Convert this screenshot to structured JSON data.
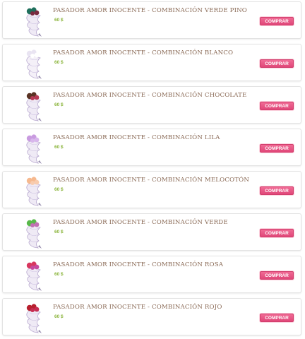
{
  "products": [
    {
      "title": "PASADOR AMOR INOCENTE - COMBINACIÓN VERDE PINO",
      "price": "60 $",
      "button": "COMPRAR",
      "colors": [
        "#1f6f5c",
        "#7a2b40",
        "#efeaf5"
      ]
    },
    {
      "title": "PASADOR AMOR INOCENTE - COMBINACIÓN BLANCO",
      "price": "60 $",
      "button": "COMPRAR",
      "colors": [
        "#e9e4f2",
        "#ffffff",
        "#f4f0f8"
      ]
    },
    {
      "title": "PASADOR AMOR INOCENTE - COMBINACIÓN CHOCOLATE",
      "price": "60 $",
      "button": "COMPRAR",
      "colors": [
        "#5a3324",
        "#b73a55",
        "#efeaf5"
      ]
    },
    {
      "title": "PASADOR AMOR INOCENTE - COMBINACIÓN LILA",
      "price": "60 $",
      "button": "COMPRAR",
      "colors": [
        "#c99be0",
        "#d8b6ec",
        "#efeaf5"
      ]
    },
    {
      "title": "PASADOR AMOR INOCENTE - COMBINACIÓN MELOCOTÓN",
      "price": "60 $",
      "button": "COMPRAR",
      "colors": [
        "#f6b98f",
        "#f9ccae",
        "#efeaf5"
      ]
    },
    {
      "title": "PASADOR AMOR INOCENTE - COMBINACIÓN VERDE",
      "price": "60 $",
      "button": "COMPRAR",
      "colors": [
        "#58b84a",
        "#c26fb4",
        "#efeaf5"
      ]
    },
    {
      "title": "PASADOR AMOR INOCENTE - COMBINACIÓN ROSA",
      "price": "60 $",
      "button": "COMPRAR",
      "colors": [
        "#d8375f",
        "#c64a9e",
        "#efeaf5"
      ]
    },
    {
      "title": "PASADOR AMOR INOCENTE - COMBINACIÓN ROJO",
      "price": "60 $",
      "button": "COMPRAR",
      "colors": [
        "#b8202f",
        "#c72d52",
        "#efeaf5"
      ]
    }
  ]
}
